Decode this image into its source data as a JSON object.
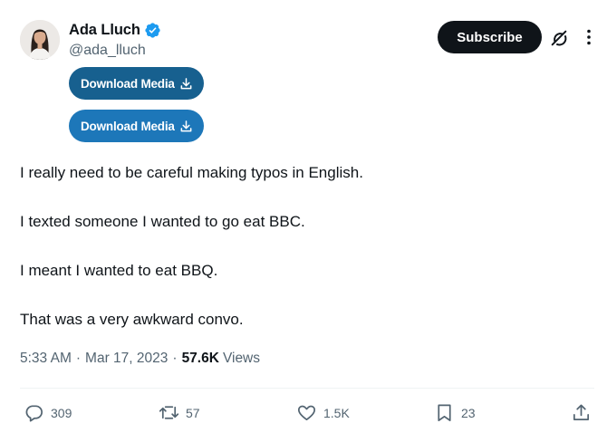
{
  "author": {
    "display_name": "Ada Lluch",
    "handle": "@ada_lluch",
    "verified": true
  },
  "header": {
    "subscribe_label": "Subscribe",
    "grok_icon": "grok-icon",
    "more_icon": "more-icon"
  },
  "media_buttons": [
    {
      "label": "Download Media",
      "icon": "download-icon"
    },
    {
      "label": "Download Media",
      "icon": "download-icon"
    }
  ],
  "tweet": {
    "lines": [
      "I really need to be careful making typos in English.",
      "I texted someone I wanted to go eat BBC.",
      "I meant I wanted to eat BBQ.",
      "That was a very awkward convo."
    ]
  },
  "meta": {
    "time": "5:33 AM",
    "separator": "·",
    "date": "Mar 17, 2023",
    "views_count": "57.6K",
    "views_label": "Views"
  },
  "actions": {
    "replies": "309",
    "reposts": "57",
    "likes": "1.5K",
    "bookmarks": "23"
  },
  "colors": {
    "accent_dark": "#17608f",
    "accent": "#1d77b9",
    "verified": "#1d9bf0",
    "text": "#0f1419",
    "muted": "#536471"
  }
}
